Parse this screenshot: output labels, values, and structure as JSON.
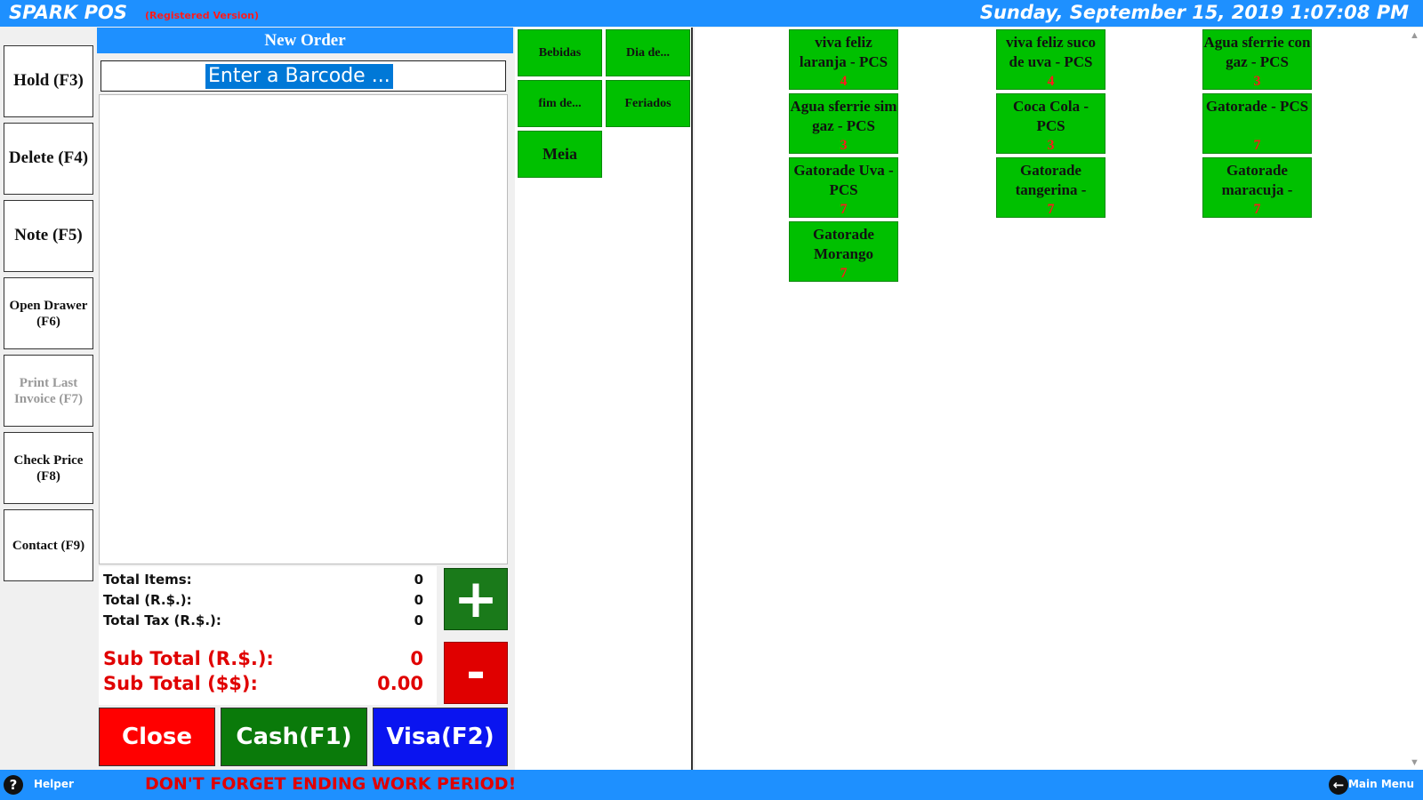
{
  "header": {
    "app_title": "SPARK POS",
    "registration": "(Registered Version)",
    "datetime": "Sunday, September 15, 2019 1:07:08 PM"
  },
  "functions": [
    {
      "label": "Hold (F3)",
      "enabled": true
    },
    {
      "label": "Delete (F4)",
      "enabled": true
    },
    {
      "label": "Note (F5)",
      "enabled": true
    },
    {
      "label": "Open Drawer (F6)",
      "enabled": true
    },
    {
      "label": "Print Last Invoice (F7)",
      "enabled": false
    },
    {
      "label": "Check Price (F8)",
      "enabled": true
    },
    {
      "label": "Contact (F9)",
      "enabled": true
    }
  ],
  "order": {
    "title": "New Order",
    "barcode_placeholder": "Enter a Barcode ...",
    "total_items_label": "Total Items:",
    "total_items": "0",
    "total_label": "Total (R.$.):",
    "total": "0",
    "total_tax_label": "Total Tax (R.$.):",
    "total_tax": "0",
    "subtotal_rs_label": "Sub Total (R.$.):",
    "subtotal_rs": "0",
    "subtotal_usd_label": "Sub Total ($$):",
    "subtotal_usd": "0.00",
    "plus_label": "+",
    "minus_label": "-"
  },
  "payment": {
    "close_label": "Close",
    "cash_label": "Cash(F1)",
    "visa_label": "Visa(F2)"
  },
  "categories": [
    "Bebidas",
    "Dia de...",
    "fim de...",
    "Feriados",
    "Meia"
  ],
  "products": [
    {
      "name": "viva feliz laranja - PCS",
      "qty": "4"
    },
    {
      "name": "viva feliz suco de uva - PCS",
      "qty": "4"
    },
    {
      "name": "Agua sferrie con gaz - PCS",
      "qty": "3"
    },
    {
      "name": "Agua sferrie sim gaz - PCS",
      "qty": "3"
    },
    {
      "name": "Coca Cola - PCS",
      "qty": "3"
    },
    {
      "name": "Gatorade - PCS",
      "qty": "7"
    },
    {
      "name": "Gatorade Uva - PCS",
      "qty": "7"
    },
    {
      "name": "Gatorade tangerina -",
      "qty": "7"
    },
    {
      "name": "Gatorade maracuja -",
      "qty": "7"
    },
    {
      "name": "Gatorade Morango",
      "qty": "7"
    }
  ],
  "footer": {
    "helper_icon": "help-icon",
    "helper_label": "Helper",
    "warning": "DON'T FORGET ENDING WORK PERIOD!",
    "mainmenu_icon": "arrow-left-icon",
    "mainmenu_label": "Main Menu"
  },
  "colors": {
    "bar_blue": "#1e90ff",
    "product_green": "#00c000",
    "alert_red": "#e00000"
  }
}
